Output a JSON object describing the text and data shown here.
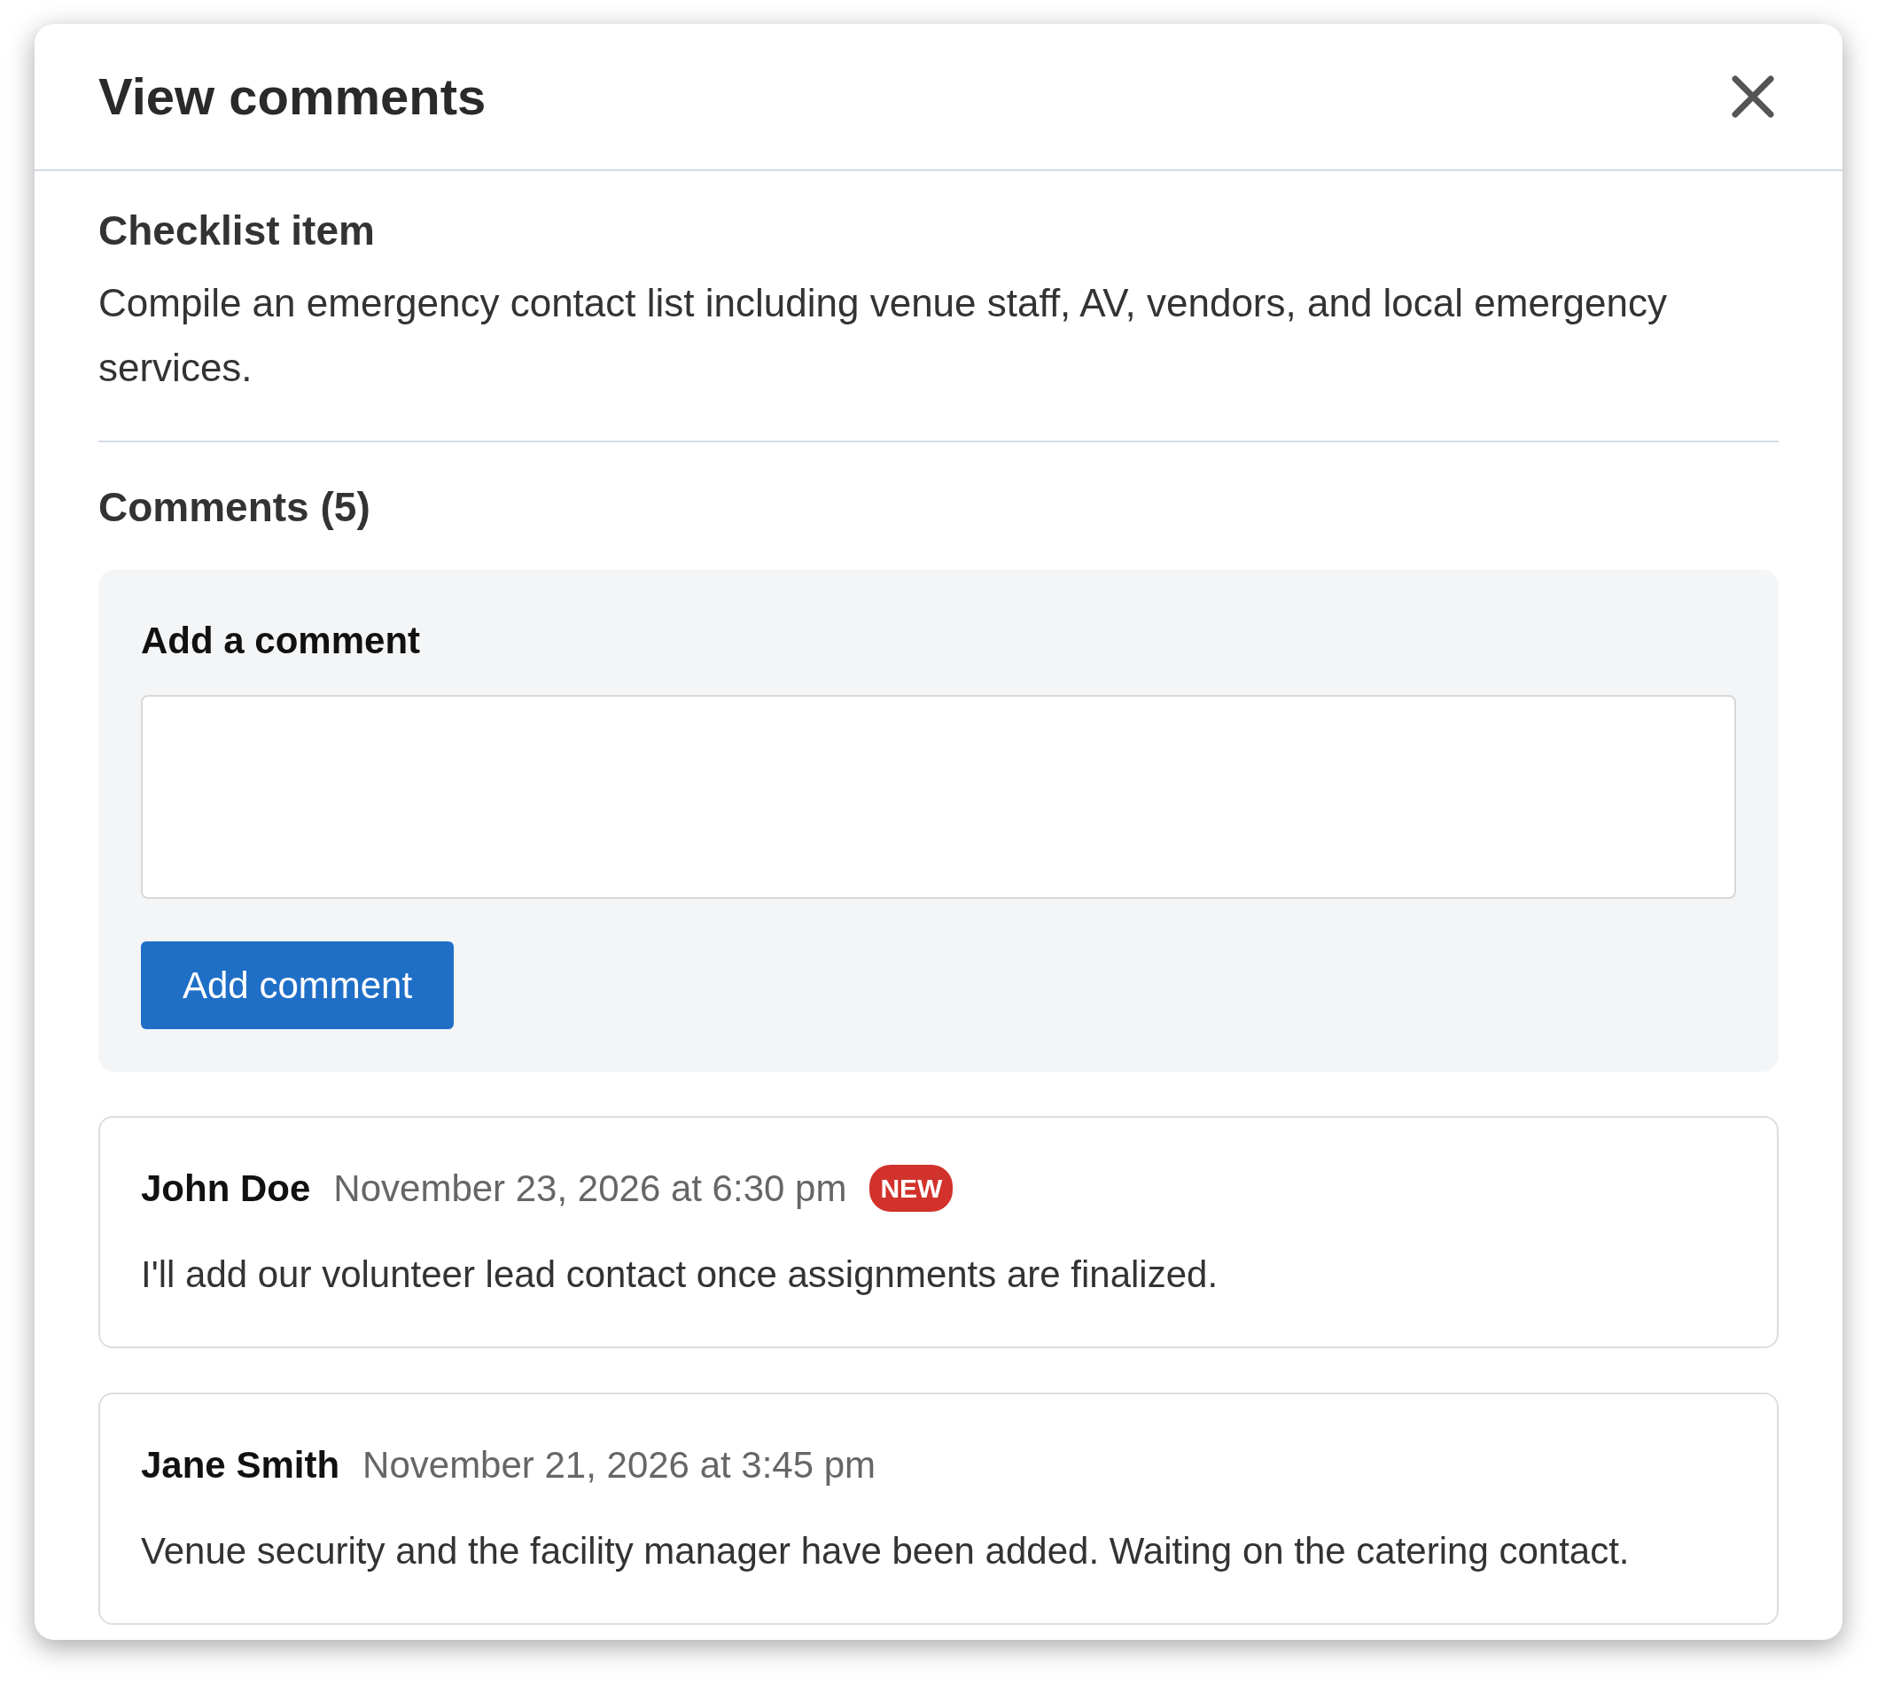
{
  "dialog": {
    "title": "View comments"
  },
  "checklist_item": {
    "heading": "Checklist item",
    "text": "Compile an emergency contact list including venue staff, AV, vendors, and local emergency services."
  },
  "comments_heading": "Comments (5)",
  "add_comment": {
    "label": "Add a comment",
    "button": "Add comment"
  },
  "comments": [
    {
      "author": "John Doe",
      "time": "November 23, 2026 at 6:30 pm",
      "badge": "NEW",
      "text": "I'll add our volunteer lead contact once assignments are finalized."
    },
    {
      "author": "Jane Smith",
      "time": "November 21, 2026 at 3:45 pm",
      "text": "Venue security and the facility manager have been added. Waiting on the catering contact."
    }
  ]
}
